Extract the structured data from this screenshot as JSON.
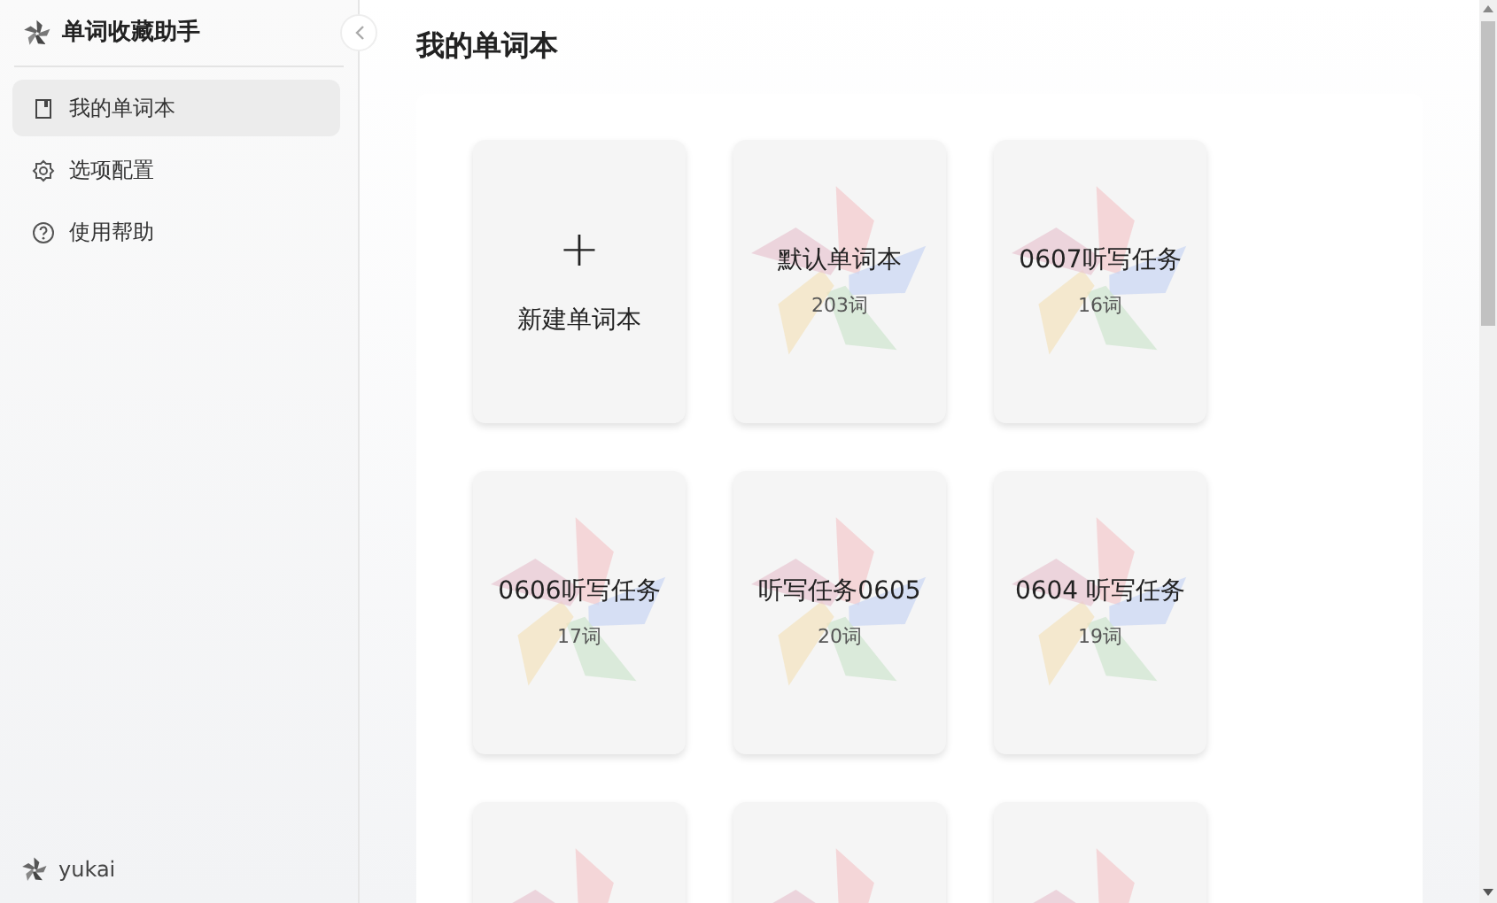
{
  "sidebar": {
    "app_title": "单词收藏助手",
    "items": [
      {
        "label": "我的单词本",
        "kind": "book",
        "selected": true
      },
      {
        "label": "选项配置",
        "kind": "gear",
        "selected": false
      },
      {
        "label": "使用帮助",
        "kind": "help",
        "selected": false
      }
    ],
    "user": "yukai"
  },
  "page_title": "我的单词本",
  "new_book": {
    "icon": "+",
    "label": "新建单词本"
  },
  "books": [
    {
      "kind": "book",
      "title": "默认单词本",
      "count": "203词"
    },
    {
      "kind": "book",
      "title": "0607听写任务",
      "count": "16词"
    },
    {
      "kind": "book",
      "title": "0606听写任务",
      "count": "17词"
    },
    {
      "kind": "book",
      "title": "听写任务0605",
      "count": "20词"
    },
    {
      "kind": "book",
      "title": "0604 听写任务",
      "count": "19词"
    },
    {
      "kind": "cut"
    },
    {
      "kind": "cut"
    },
    {
      "kind": "cut"
    }
  ]
}
